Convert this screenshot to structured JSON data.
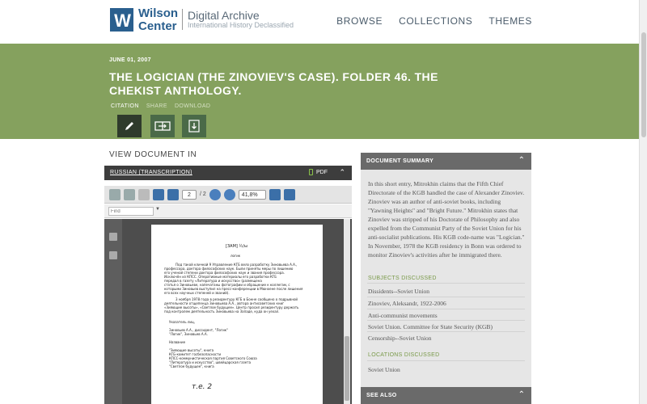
{
  "header": {
    "logo_mark": "W",
    "logo_name_line1": "Wilson",
    "logo_name_line2": "Center",
    "site_title": "Digital Archive",
    "site_subtitle": "International History Declassified",
    "nav": [
      "BROWSE",
      "COLLECTIONS",
      "THEMES"
    ]
  },
  "document": {
    "date": "JUNE 01, 2007",
    "title": "THE LOGICIAN (THE ZINOVIEV'S CASE). FOLDER 46. THE CHEKIST ANTHOLOGY.",
    "tabs": [
      "CITATION",
      "SHARE",
      "DOWNLOAD"
    ],
    "active_tab": "CITATION"
  },
  "viewer": {
    "section_title": "VIEW DOCUMENT IN",
    "language_tab": "RUSSIAN (TRANSCRIPTION)",
    "format": "PDF",
    "page_current": "2",
    "page_total": "/ 2",
    "zoom": "41,8%",
    "find_placeholder": "Find",
    "page_lines": [
      "[ЗАМ]       ½/ы",
      "логик",
      "Под такой кличкой 9 Управление КГБ вело разработку Зиновьева А.А.,",
      "профессора, доктора философских наук. Были приняты меры по лишению",
      "его ученой степени доктора философских наук и звания профессора.",
      "Исключён из КПСС. Оперативные материалы его разработки КГБ",
      "передал в газету «Литература и искусство» (размещена",
      "статья о Зиновьеве, напечатаны фотографии и обращение к коллегам, с",
      "которыми Зиновьев выступил на пресс-конференции в Мюнхене после лишения",
      "его всех научных степеней и званий).",
      "3 ноября 1978 года в резидентуру КГБ в Бонне сообщено о подрывной",
      "деятельности отщепенца Зиновьева А.А., автора антисоветских книг",
      "«Зияющие высоты», «Светлое будущее». Центр просил резидентуру держать",
      "под контролем деятельность Зиновьева на Западе, куда он уехал.",
      "Указатель лиц,",
      "Зиновьев А.А., диссидент, \"Логик\"",
      "\"Логик\", Зиновьев А.А.",
      "Название",
      "\"Зияющие высоты\", книга",
      "КГБ-комитет госбезопасности",
      "КПСС-коммунистическая партия Советского Союза",
      "\"Литература и искусство\", швейцарская газета",
      "\"Светлое будущее\", книга",
      "т.е. 2"
    ]
  },
  "summary": {
    "heading": "DOCUMENT SUMMARY",
    "text": "In this short entry, Mitrokhin claims that the Fifth Chief Directorate of the KGB handled the case of Alexander Zinoviev. Zinoviev was an author of anti-soviet books, including \"Yawning Heights\" and \"Bright Future.\" Mitrokhin states that Zinoviev was stripped of his Doctorate of Philosophy and also expelled from the Communist Party of the Soviet Union for his anti-socialist publications. His KGB code-name was \"Logician.\" In November, 1978 the KGB residency in Bonn was ordered to monitor Zinoviev's activities after he immigrated there.",
    "subjects_label": "SUBJECTS DISCUSSED",
    "subjects": [
      "Dissidents--Soviet Union",
      "Zinoviev, Aleksandr, 1922-2006",
      "Anti-communist movements",
      "Soviet Union. Committee for State Security (KGB)",
      "Censorship--Soviet Union"
    ],
    "locations_label": "LOCATIONS DISCUSSED",
    "locations": [
      "Soviet Union"
    ],
    "see_also_heading": "SEE ALSO"
  },
  "icons": {
    "citation": "pencil-icon",
    "share": "share-icon",
    "download": "download-icon"
  },
  "colors": {
    "band": "#85a15e",
    "brand": "#2a5f8e",
    "accent_label": "#7a9a4a"
  }
}
